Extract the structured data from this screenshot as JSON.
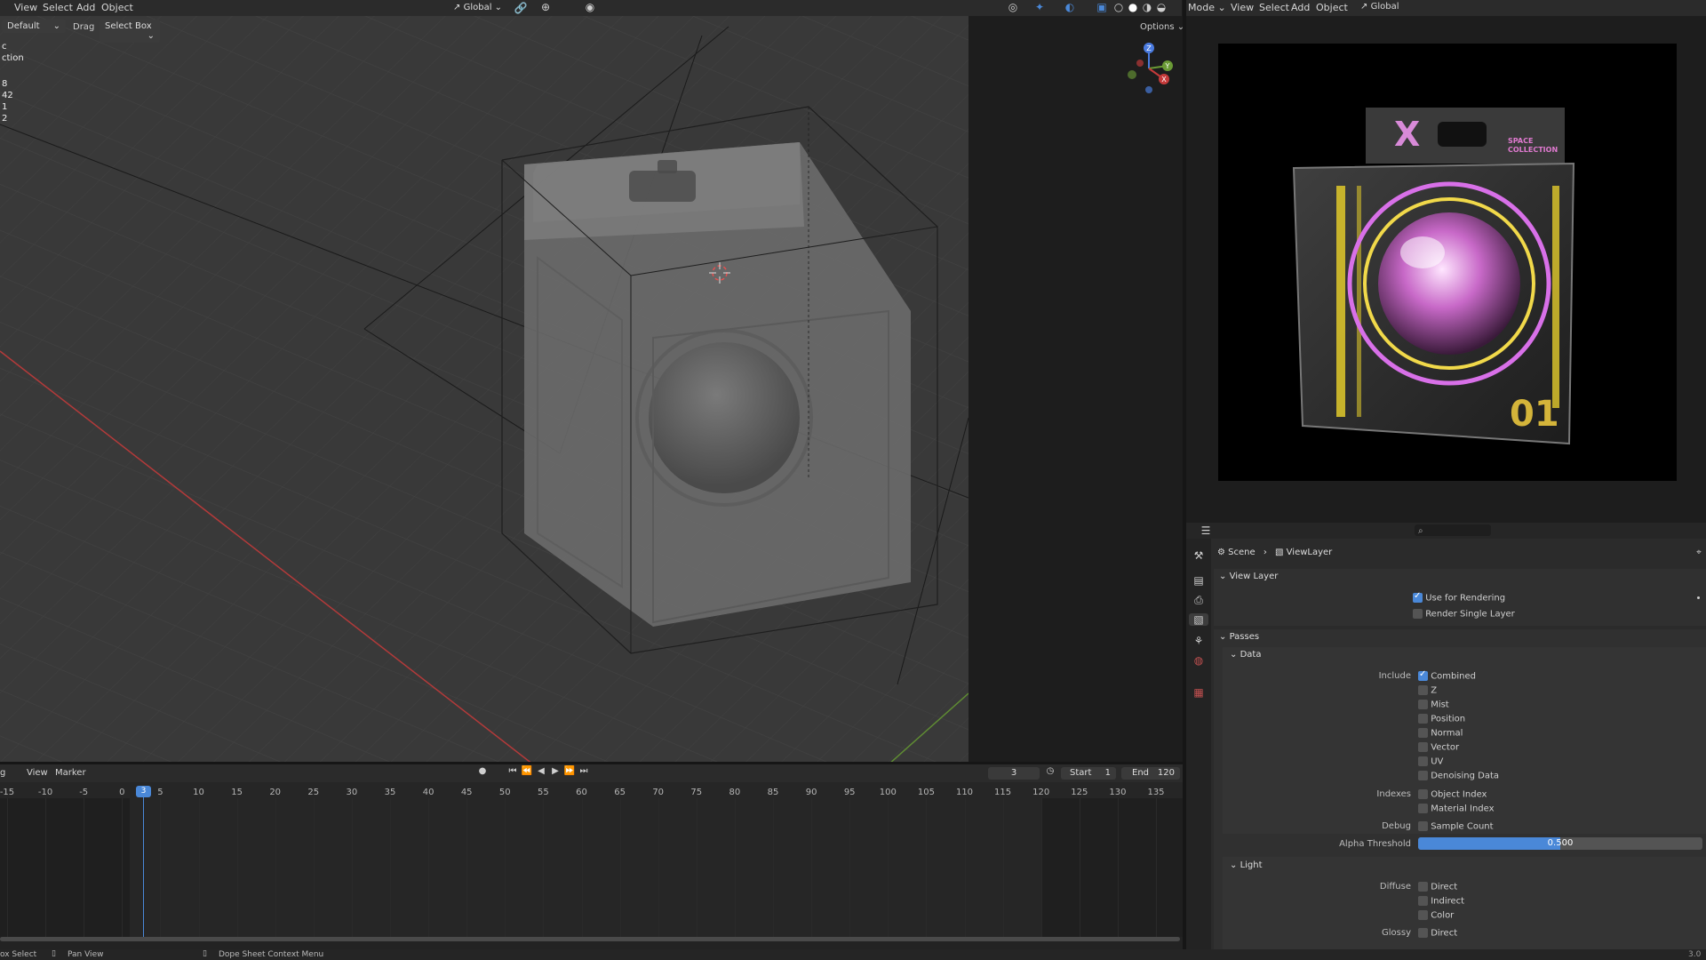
{
  "viewport_header": {
    "menus": [
      "View",
      "Select",
      "Add",
      "Object"
    ],
    "transform_orientation": "Global",
    "options_label": "Options"
  },
  "tool_header": {
    "orientation_label": "Default",
    "drag_label": "Drag",
    "select_mode": "Select Box"
  },
  "overlay_text": [
    "c",
    "ction",
    "8",
    "42",
    "1",
    "2"
  ],
  "right_header": {
    "mode_label": "Mode",
    "menus": [
      "View",
      "Select",
      "Add",
      "Object"
    ],
    "transform_orientation": "Global"
  },
  "render_preview": {
    "logo": "X",
    "brand_line1": "SPACE",
    "brand_line2": "COLLECTION",
    "number": "01"
  },
  "properties": {
    "breadcrumb_scene": "Scene",
    "breadcrumb_layer": "ViewLayer",
    "section_view_layer": "View Layer",
    "use_for_rendering": "Use for Rendering",
    "render_single_layer": "Render Single Layer",
    "section_passes": "Passes",
    "subsection_data": "Data",
    "include_label": "Include",
    "include_items": [
      {
        "label": "Combined",
        "checked": true
      },
      {
        "label": "Z",
        "checked": false
      },
      {
        "label": "Mist",
        "checked": false
      },
      {
        "label": "Position",
        "checked": false
      },
      {
        "label": "Normal",
        "checked": false
      },
      {
        "label": "Vector",
        "checked": false
      },
      {
        "label": "UV",
        "checked": false
      },
      {
        "label": "Denoising Data",
        "checked": false
      }
    ],
    "indexes_label": "Indexes",
    "indexes_items": [
      "Object Index",
      "Material Index"
    ],
    "debug_label": "Debug",
    "debug_item": "Sample Count",
    "alpha_threshold_label": "Alpha Threshold",
    "alpha_threshold_value": "0.500",
    "alpha_threshold_fraction": 0.5,
    "subsection_light": "Light",
    "diffuse_label": "Diffuse",
    "diffuse_items": [
      "Direct",
      "Indirect",
      "Color"
    ],
    "glossy_label": "Glossy",
    "glossy_items": [
      "Direct"
    ]
  },
  "timeline": {
    "menus": [
      "g",
      "View",
      "Marker"
    ],
    "current_frame": "3",
    "start_label": "Start",
    "start_value": "1",
    "end_label": "End",
    "end_value": "120",
    "ticks": [
      "-15",
      "-10",
      "-5",
      "0",
      "5",
      "10",
      "15",
      "20",
      "25",
      "30",
      "35",
      "40",
      "45",
      "50",
      "55",
      "60",
      "65",
      "70",
      "75",
      "80",
      "85",
      "90",
      "95",
      "100",
      "105",
      "110",
      "115",
      "120",
      "125",
      "130",
      "135"
    ],
    "playhead_label": "3"
  },
  "status_bar": {
    "item1": "ox Select",
    "item2": "Pan View",
    "item3": "Dope Sheet Context Menu",
    "version": "3.0"
  },
  "colors": {
    "accent_blue": "#4a88d8",
    "x_axis_red": "#c53a3a",
    "y_axis_green": "#6a9a35",
    "viewport_bg": "#3a3a3a"
  }
}
